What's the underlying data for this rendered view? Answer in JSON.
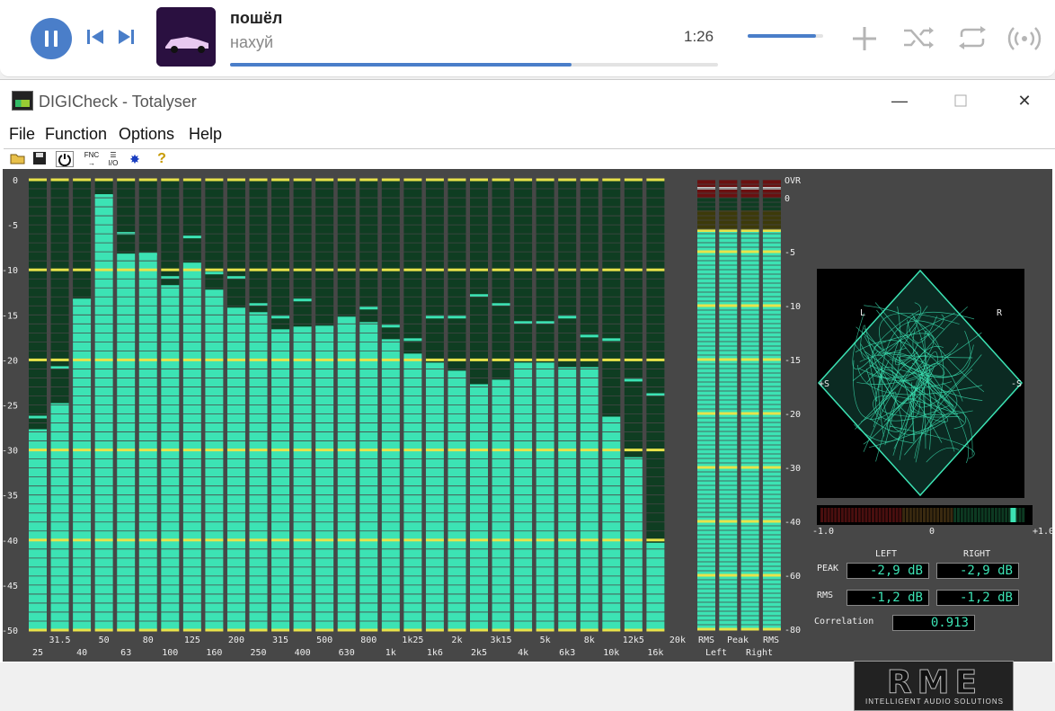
{
  "player": {
    "track_title": "пошёл",
    "track_artist": "нахуй",
    "time": "1:26",
    "progress": 0.7,
    "volume": 0.9,
    "accent": "#4a7ec9"
  },
  "window": {
    "title": "DIGICheck - Totalyser",
    "menu": [
      "File",
      "Function",
      "Options",
      "Help"
    ],
    "toolbar_icons": [
      "open-icon",
      "save-icon",
      "power-icon",
      "fnc-icon",
      "io-icon",
      "bug-icon",
      "help-icon"
    ],
    "toolbar_text": {
      "fnc": "FNC",
      "io": "I/O",
      "help": "?"
    }
  },
  "analyzer": {
    "y_ticks": [
      "0",
      "-5",
      "-10",
      "-15",
      "-20",
      "-25",
      "-30",
      "-35",
      "-40",
      "-45",
      "-50"
    ],
    "band_labels_bottom": [
      "25",
      "40",
      "63",
      "100",
      "160",
      "250",
      "400",
      "630",
      "1k",
      "1k6",
      "2k5",
      "4k",
      "6k3",
      "10k",
      "16k"
    ],
    "band_labels_top": [
      "31.5",
      "50",
      "80",
      "125",
      "200",
      "315",
      "500",
      "800",
      "1k25",
      "2k",
      "3k15",
      "5k",
      "8k",
      "12k5",
      "20k"
    ],
    "levels": [
      -27.7,
      -24.8,
      -13.3,
      -1.7,
      -8.2,
      -8.2,
      -11.7,
      -9.2,
      -12.2,
      -14.2,
      -14.7,
      -16.6,
      -16.3,
      -16.3,
      -15.2,
      -15.8,
      -17.7,
      -19.3,
      -20.3,
      -21.2,
      -22.7,
      -22.2,
      -20.3,
      -20.3,
      -20.8,
      -20.8,
      -26.3,
      -30.8,
      -40.3
    ],
    "peaks": [
      -26.3,
      -20.8,
      -13.3,
      -1.7,
      -5.9,
      -8.2,
      -10.8,
      -6.3,
      -10.3,
      -10.8,
      -13.8,
      -15.2,
      -13.3,
      -16.3,
      -16.2,
      -14.2,
      -16.2,
      -17.7,
      -15.2,
      -15.2,
      -12.8,
      -13.8,
      -15.8,
      -15.8,
      -15.2,
      -17.3,
      -17.7,
      -22.2,
      -23.8,
      -31.3
    ],
    "color_bar": "#3ce3b4",
    "color_mark": "#e8e24a"
  },
  "level_meter": {
    "scale": [
      "OVR",
      "0",
      "-5",
      "-10",
      "-15",
      "-20",
      "-30",
      "-40",
      "-60",
      "-80"
    ],
    "labels_row1": [
      "RMS",
      "Peak",
      "RMS"
    ],
    "labels_row2": [
      "Left",
      "Right"
    ],
    "values_db": [
      -2.9,
      -2.9,
      -2.9,
      -2.9
    ]
  },
  "goniometer": {
    "label_l": "L",
    "label_r": "R",
    "label_ps_left": "+S",
    "label_ps_right": "-S"
  },
  "correlation_meter": {
    "left": "-1.0",
    "mid": "0",
    "right": "+1.0",
    "value": 0.913
  },
  "readouts": {
    "left_header": "LEFT",
    "right_header": "RIGHT",
    "peak_label": "PEAK",
    "rms_label": "RMS",
    "peak_left": "-2,9 dB",
    "peak_right": "-2,9 dB",
    "rms_left": "-1,2 dB",
    "rms_right": "-1,2 dB",
    "correlation_label": "Correlation",
    "correlation_value": "0.913"
  },
  "logo": {
    "text": "RME",
    "subtitle": "INTELLIGENT AUDIO SOLUTIONS"
  }
}
